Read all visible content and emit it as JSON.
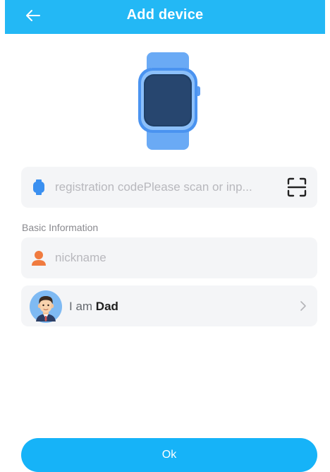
{
  "header": {
    "title": "Add device",
    "back_icon": "arrow-left-icon"
  },
  "registration": {
    "placeholder": "registration codePlease scan or inp...",
    "value": "",
    "icon": "watch-icon",
    "scan_icon": "scan-icon"
  },
  "basic_info": {
    "label": "Basic Information"
  },
  "nickname": {
    "placeholder": "nickname",
    "value": "",
    "icon": "person-icon"
  },
  "role": {
    "prefix": "I am",
    "value": "Dad",
    "icon": "dad-avatar-icon",
    "chevron_icon": "chevron-right-icon"
  },
  "ok_button": {
    "label": "Ok"
  },
  "colors": {
    "accent": "#16b3f8",
    "header_bg": "#23b8f5",
    "field_bg": "#f4f5f7",
    "nickname_icon": "#f07b3f",
    "watch_icon": "#3b90f0"
  }
}
